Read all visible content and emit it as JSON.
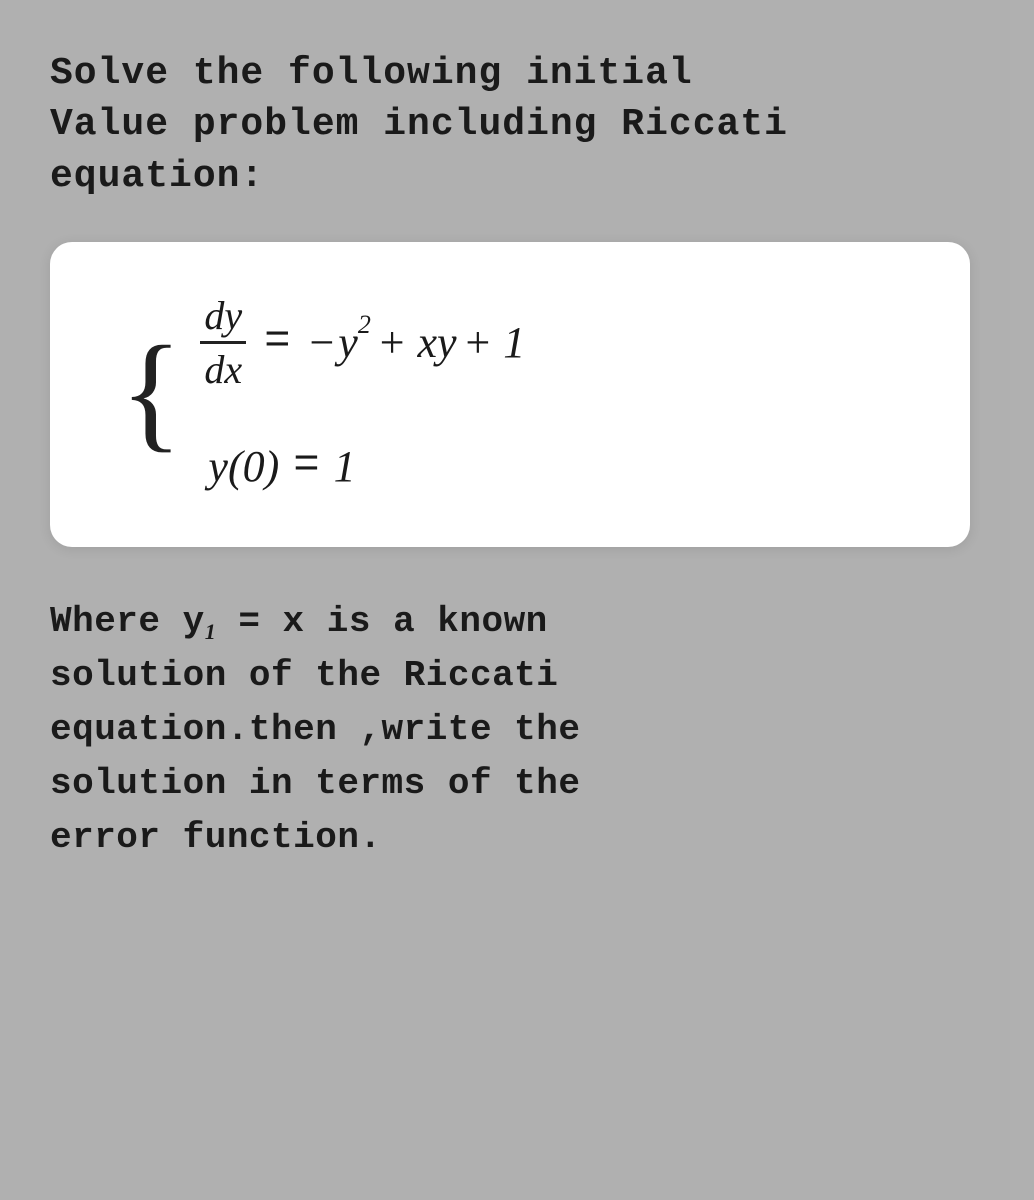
{
  "title_line1": "Solve the following initial",
  "title_line2": "Value problem including Riccati",
  "title_line3": "equation:",
  "equation1_lhs": "dy/dx",
  "equation1_rhs": "= -y² + xy + 1",
  "equation2": "y(0) = 1",
  "description_line1": "Where y₁ = x is a known",
  "description_line2": "solution of the Riccati",
  "description_line3": "equation.then ,write the",
  "description_line4": "solution in terms of the",
  "description_line5": "error function.",
  "colors": {
    "background": "#b0b0b0",
    "text": "#1a1a1a",
    "box_bg": "#ffffff"
  }
}
